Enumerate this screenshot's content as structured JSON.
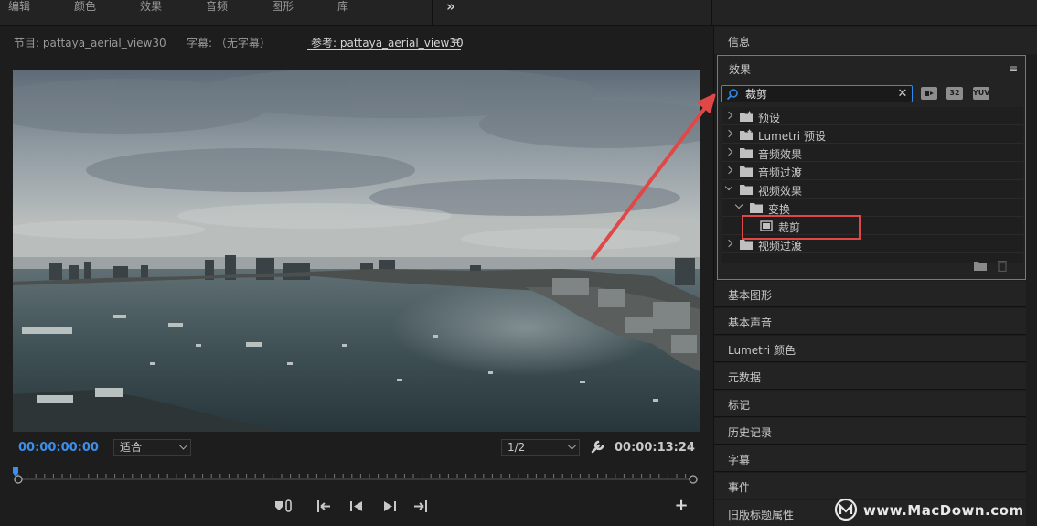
{
  "workspace": {
    "tabs": [
      "编辑",
      "颜色",
      "效果",
      "音频",
      "图形",
      "库"
    ],
    "more_label": "»"
  },
  "monitor": {
    "tabs": [
      {
        "label": "节目: pattaya_aerial_view30",
        "active": false
      },
      {
        "label": "字幕: （无字幕）",
        "active": false
      },
      {
        "label": "参考: pattaya_aerial_view30",
        "active": true
      }
    ],
    "current_time": "00:00:00:00",
    "fit_select": "适合",
    "resolution_select": "1/2",
    "duration": "00:00:13:24",
    "playhead_position": 0.0
  },
  "panels": {
    "info": "信息",
    "effects": {
      "title": "效果",
      "search_value": "裁剪",
      "filters": [
        "加速",
        "32",
        "YUV"
      ],
      "tree": [
        {
          "label": "预设",
          "level": 0,
          "expanded": false,
          "icon": "preset-folder-icon"
        },
        {
          "label": "Lumetri 预设",
          "level": 0,
          "expanded": false,
          "icon": "preset-folder-icon"
        },
        {
          "label": "音频效果",
          "level": 0,
          "expanded": false,
          "icon": "folder-icon"
        },
        {
          "label": "音频过渡",
          "level": 0,
          "expanded": false,
          "icon": "folder-icon"
        },
        {
          "label": "视频效果",
          "level": 0,
          "expanded": true,
          "icon": "folder-icon"
        },
        {
          "label": "变换",
          "level": 1,
          "expanded": true,
          "icon": "folder-icon"
        },
        {
          "label": "裁剪",
          "level": 2,
          "expanded": false,
          "icon": "effect-icon"
        },
        {
          "label": "视频过渡",
          "level": 0,
          "expanded": false,
          "icon": "folder-icon"
        }
      ]
    },
    "collapsed": [
      "基本图形",
      "基本声音",
      "Lumetri 颜色",
      "元数据",
      "标记",
      "历史记录",
      "字幕",
      "事件",
      "旧版标题属性"
    ]
  },
  "colors": {
    "accent_blue": "#2d8ceb",
    "timecode_blue": "#3d8eea",
    "annotation_red": "#e04848"
  },
  "watermark": "www.MacDown.com"
}
